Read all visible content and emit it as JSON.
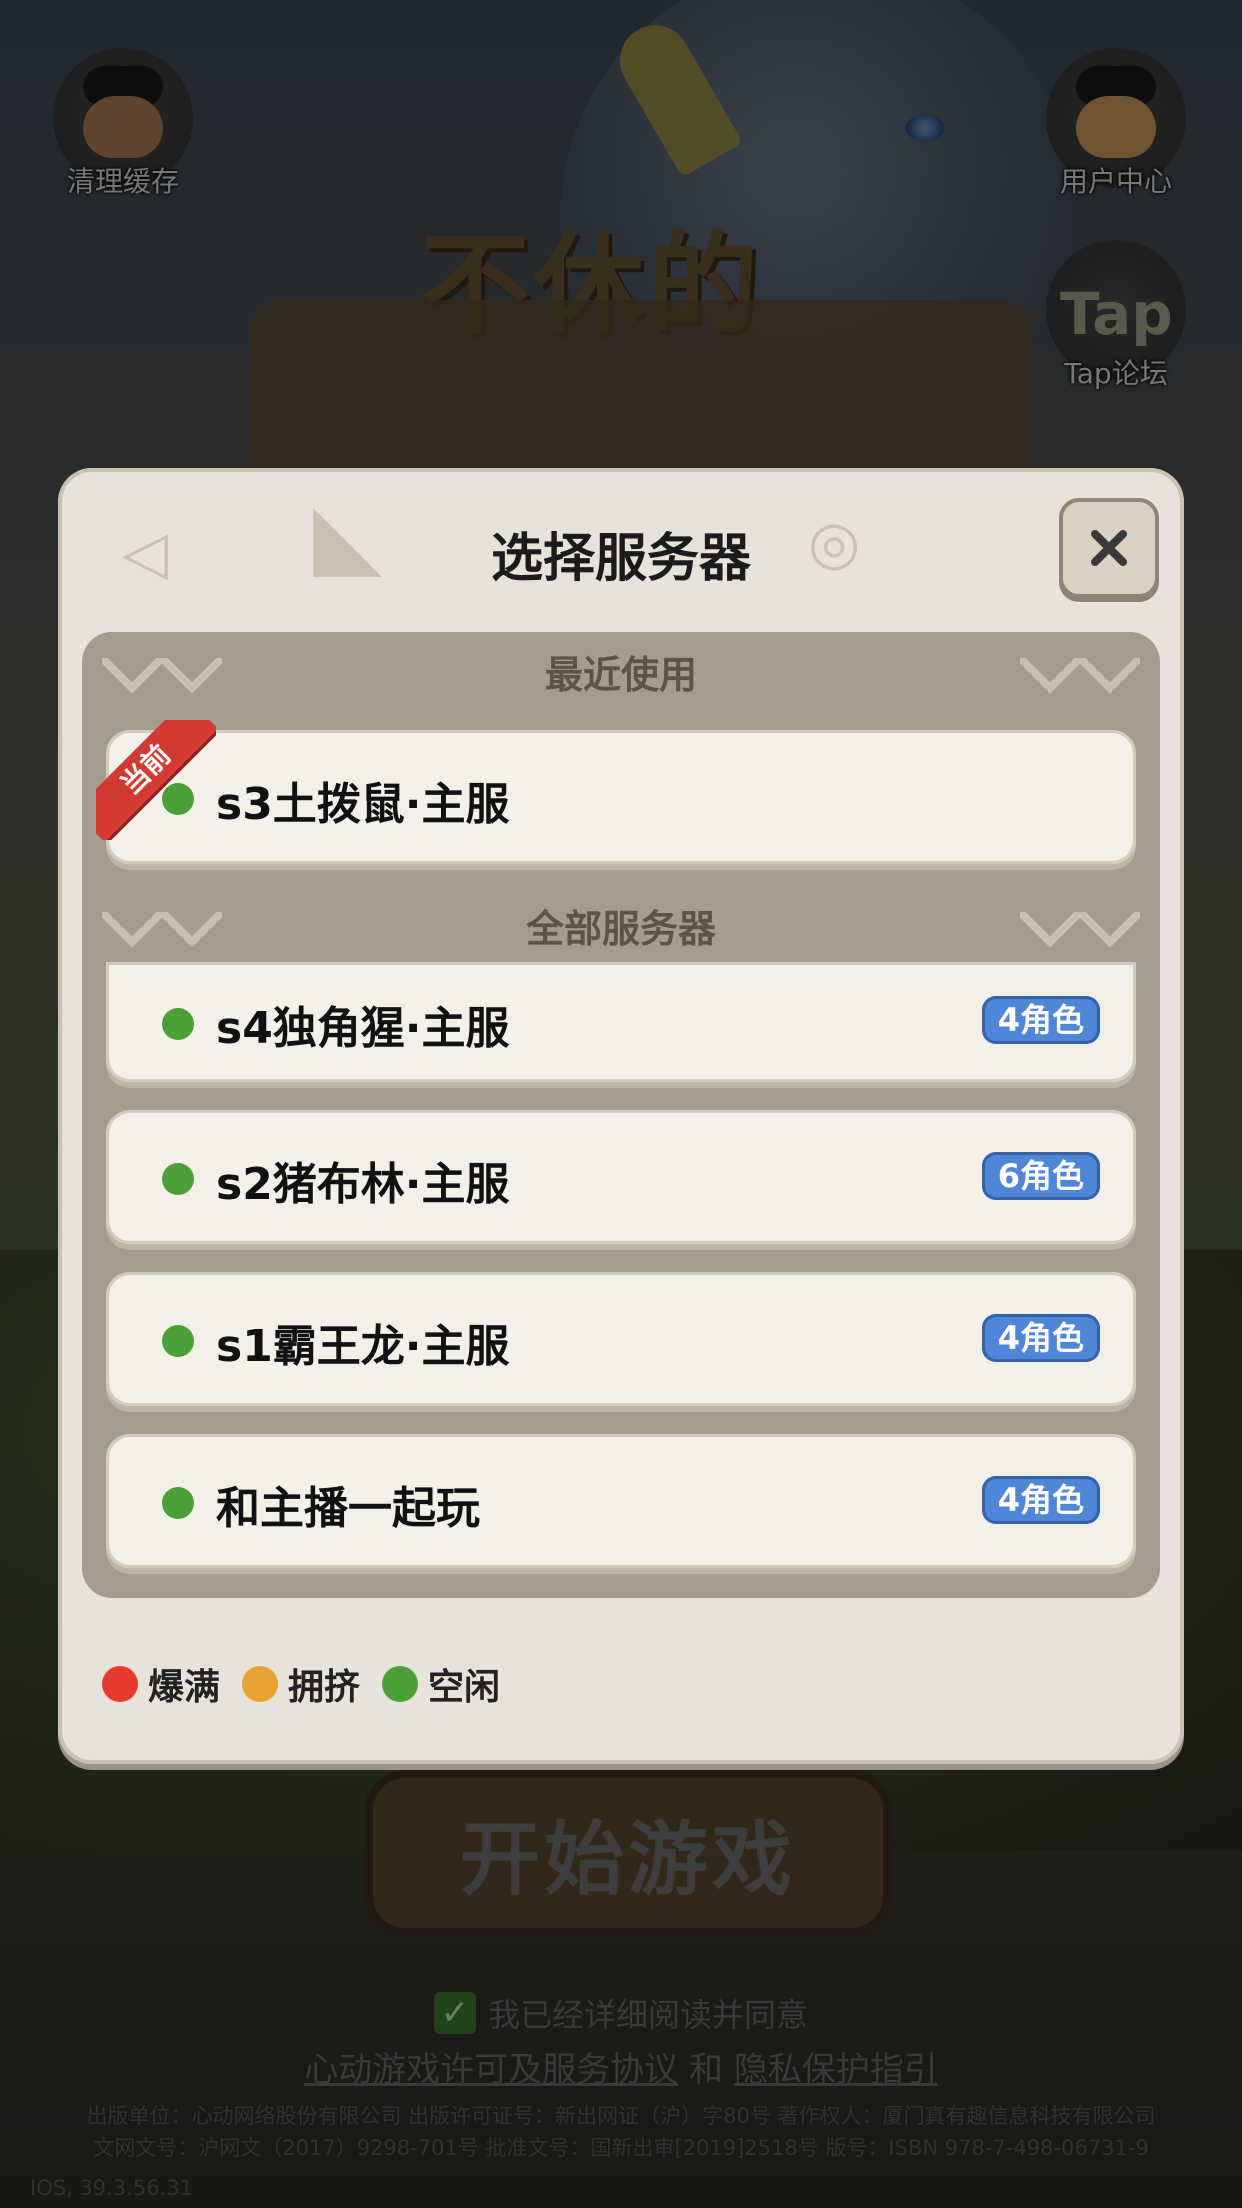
{
  "background": {
    "top_left_button": {
      "label": "清理缓存",
      "icon": "caveman-icon"
    },
    "top_right_button": {
      "label": "用户中心",
      "icon": "user-avatar-icon"
    },
    "forum_button": {
      "label": "Tap论坛",
      "icon_text": "Tap"
    },
    "game_logo_line1": "不休的",
    "start_button": "开始游戏",
    "agree_text": "我已经详细阅读并同意",
    "license_link": "心动游戏许可及服务协议",
    "and_text": "和",
    "privacy_link": "隐私保护指引",
    "legal_line1": "出版单位：心动网络股份有限公司 出版许可证号：新出网证（沪）字80号 著作权人：厦门真有趣信息科技有限公司",
    "legal_line2": "文网文号：沪网文（2017）9298-701号 批准文号：国新出审[2019]2518号 版号：ISBN 978-7-498-06731-9",
    "version": "IOS, 39.3.56.31"
  },
  "modal": {
    "title": "选择服务器",
    "recent_header": "最近使用",
    "all_header": "全部服务器",
    "current_ribbon": "当前",
    "recent_servers": [
      {
        "name": "s3土拨鼠·主服",
        "status": "green"
      }
    ],
    "all_servers": [
      {
        "name": "s4独角猩·主服",
        "badge": "4角色",
        "status": "green"
      },
      {
        "name": "s2猪布林·主服",
        "badge": "6角色",
        "status": "green"
      },
      {
        "name": "s1霸王龙·主服",
        "badge": "4角色",
        "status": "green"
      },
      {
        "name": "和主播一起玩",
        "badge": "4角色",
        "status": "green"
      }
    ],
    "legend": [
      {
        "label": "爆满",
        "color": "#e63a2e"
      },
      {
        "label": "拥挤",
        "color": "#e8a431"
      },
      {
        "label": "空闲",
        "color": "#4b9f36"
      }
    ]
  }
}
